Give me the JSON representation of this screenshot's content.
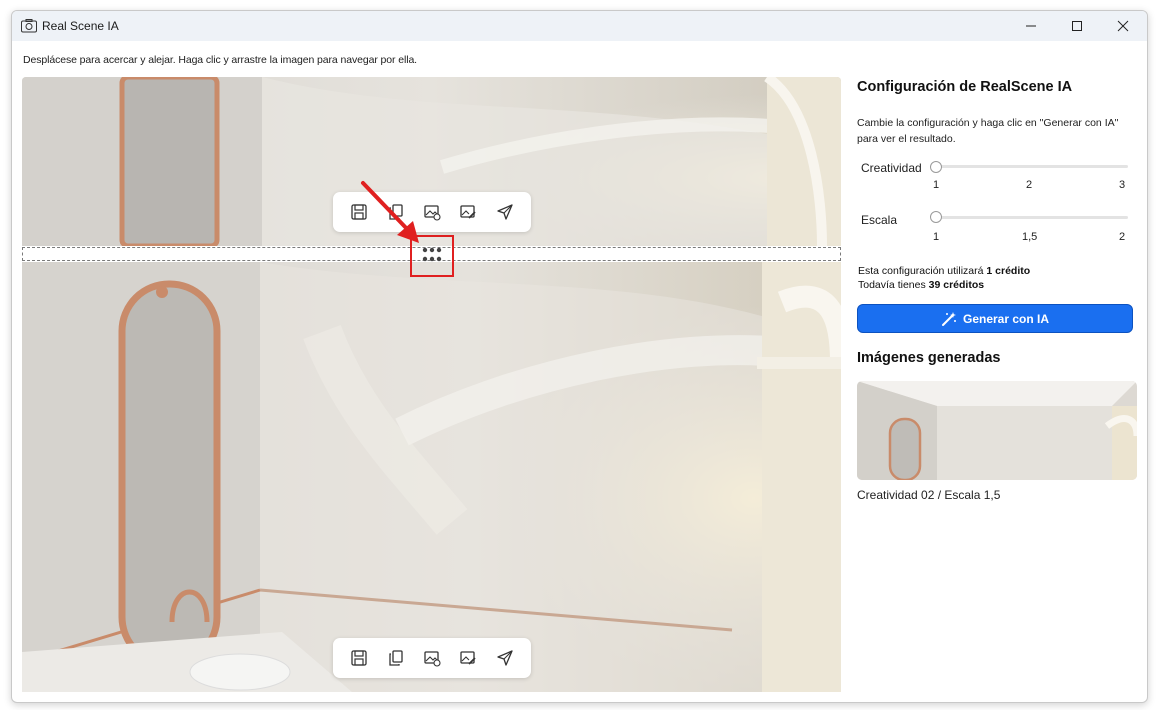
{
  "window": {
    "title": "Real Scene IA"
  },
  "hint": "Desplácese para acercar y alejar. Haga clic y arrastre la imagen para navegar por ella.",
  "toolbar_icons": [
    "save-icon",
    "copy-icon",
    "image-settings-icon",
    "edit-image-icon",
    "send-icon"
  ],
  "panel": {
    "title": "Configuración de RealScene IA",
    "description": "Cambie la configuración y haga clic en \"Generar con IA\" para ver el resultado.",
    "creatividad": {
      "label": "Creatividad",
      "ticks": [
        "1",
        "2",
        "3"
      ],
      "value": 1
    },
    "escala": {
      "label": "Escala",
      "ticks": [
        "1",
        "1,5",
        "2"
      ],
      "value": 1
    },
    "credits_line1_pre": "Esta configuración utilizará",
    "credits_line1_bold": "1 crédito",
    "credits_line2_pre": "Todavía tienes",
    "credits_line2_count": "39",
    "credits_line2_bold": "créditos",
    "generate_label": "Generar con IA",
    "generated_title": "Imágenes generadas",
    "thumb_caption": "Creatividad 02 / Escala 1,5"
  },
  "colors": {
    "accent": "#1a6ff0",
    "highlight": "#e02020",
    "mirror_frame": "#c98b6a"
  }
}
